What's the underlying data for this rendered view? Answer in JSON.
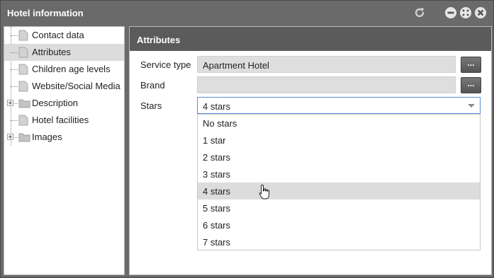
{
  "window": {
    "title": "Hotel information",
    "refresh_icon": "refresh-icon",
    "controls": [
      "minimize-icon",
      "maximize-icon",
      "close-icon"
    ]
  },
  "tree": {
    "items": [
      {
        "label": "Contact data",
        "icon": "document-icon",
        "expandable": false,
        "selected": false
      },
      {
        "label": "Attributes",
        "icon": "document-icon",
        "expandable": false,
        "selected": true
      },
      {
        "label": "Children age levels",
        "icon": "document-icon",
        "expandable": false,
        "selected": false
      },
      {
        "label": "Website/Social Media",
        "icon": "document-icon",
        "expandable": false,
        "selected": false
      },
      {
        "label": "Description",
        "icon": "folder-icon",
        "expandable": true,
        "selected": false
      },
      {
        "label": "Hotel facilities",
        "icon": "document-icon",
        "expandable": false,
        "selected": false
      },
      {
        "label": "Images",
        "icon": "folder-icon",
        "expandable": true,
        "selected": false
      }
    ]
  },
  "panel": {
    "title": "Attributes",
    "service_type": {
      "label": "Service type",
      "value": "Apartment Hotel",
      "button": "..."
    },
    "brand": {
      "label": "Brand",
      "value": "",
      "button": "..."
    },
    "stars": {
      "label": "Stars",
      "value": "4 stars",
      "options": [
        "No stars",
        "1 star",
        "2 stars",
        "3 stars",
        "4 stars",
        "5 stars",
        "6 stars",
        "7 stars"
      ],
      "hovered": "4 stars"
    }
  },
  "colors": {
    "window_bg": "#6a6a6a",
    "panel_header": "#5b5b5b",
    "selected_row": "#dcdcdc",
    "focus_border": "#5b8fd6"
  }
}
